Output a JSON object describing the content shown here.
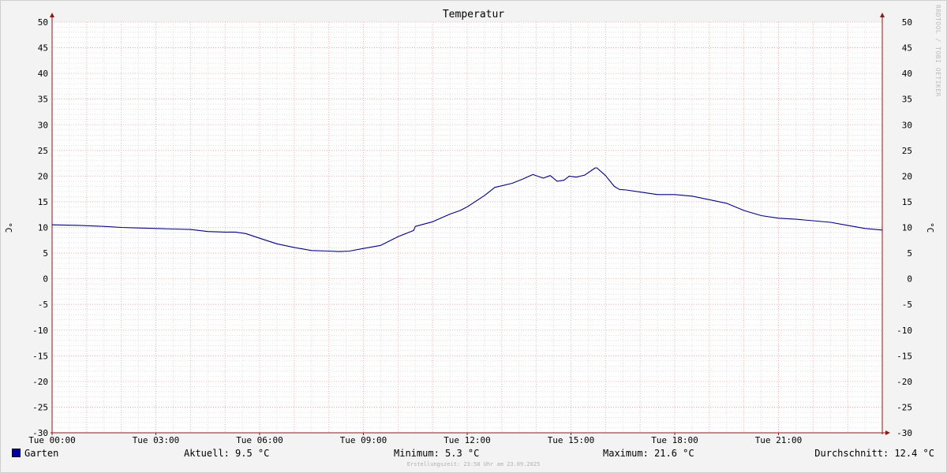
{
  "chart_data": {
    "type": "line",
    "title": "Temperatur",
    "ylabel": "°C",
    "ylim": [
      -30,
      50
    ],
    "y_major_ticks": [
      50,
      45,
      40,
      35,
      30,
      25,
      20,
      15,
      10,
      5,
      0,
      -5,
      -10,
      -15,
      -20,
      -25,
      -30
    ],
    "xlim_hours": [
      0,
      24
    ],
    "x_ticks": [
      {
        "hour": 0,
        "label": "Tue 00:00"
      },
      {
        "hour": 3,
        "label": "Tue 03:00"
      },
      {
        "hour": 6,
        "label": "Tue 06:00"
      },
      {
        "hour": 9,
        "label": "Tue 09:00"
      },
      {
        "hour": 12,
        "label": "Tue 12:00"
      },
      {
        "hour": 15,
        "label": "Tue 15:00"
      },
      {
        "hour": 18,
        "label": "Tue 18:00"
      },
      {
        "hour": 21,
        "label": "Tue 21:00"
      }
    ],
    "grid": true,
    "legend_placement": "bottom",
    "colors": {
      "background": "#f3f3f3",
      "plot_background": "#ffffff",
      "major_grid": "#f0a0a0",
      "minor_grid": "#cccccc",
      "axis": "#8b1a1a",
      "series": "#000080"
    },
    "series": [
      {
        "name": "Garten",
        "x_hours": [
          0,
          0.8,
          1.5,
          2.0,
          2.5,
          3.0,
          3.5,
          4.0,
          4.5,
          5.0,
          5.3,
          5.6,
          6.0,
          6.5,
          7.0,
          7.5,
          8.0,
          8.3,
          8.6,
          9.0,
          9.5,
          10.0,
          10.45,
          10.5,
          11.0,
          11.5,
          11.8,
          12.0,
          12.5,
          12.8,
          13.0,
          13.3,
          13.6,
          13.9,
          14.2,
          14.4,
          14.6,
          14.8,
          14.95,
          15.15,
          15.4,
          15.7,
          15.75,
          16.0,
          16.25,
          16.4,
          16.6,
          17.0,
          17.5,
          18.0,
          18.5,
          19.0,
          19.5,
          20.0,
          20.5,
          21.0,
          21.5,
          22.0,
          22.5,
          23.0,
          23.5,
          24.0
        ],
        "values": [
          10.5,
          10.4,
          10.2,
          10.0,
          9.9,
          9.8,
          9.7,
          9.6,
          9.2,
          9.1,
          9.1,
          8.8,
          7.9,
          6.8,
          6.1,
          5.5,
          5.4,
          5.3,
          5.4,
          5.9,
          6.5,
          8.2,
          9.4,
          10.2,
          11.1,
          12.6,
          13.3,
          14.0,
          16.2,
          17.8,
          18.1,
          18.6,
          19.4,
          20.3,
          19.6,
          20.1,
          19.0,
          19.2,
          20.0,
          19.8,
          20.2,
          21.6,
          21.6,
          20.1,
          18.0,
          17.4,
          17.3,
          16.9,
          16.4,
          16.4,
          16.1,
          15.4,
          14.7,
          13.3,
          12.3,
          11.8,
          11.6,
          11.3,
          11.0,
          10.4,
          9.8,
          9.5
        ]
      }
    ]
  },
  "watermark": "RRDTOOL / TOBI OETIKER",
  "legend": {
    "series_name": "Garten",
    "current": "Aktuell: 9.5 °C",
    "minimum": "Minimum: 5.3 °C",
    "maximum": "Maximum: 21.6 °C",
    "average": "Durchschnitt: 12.4 °C"
  },
  "footer": "Erstellungszeit: 23:58 Uhr am 23.09.2025"
}
